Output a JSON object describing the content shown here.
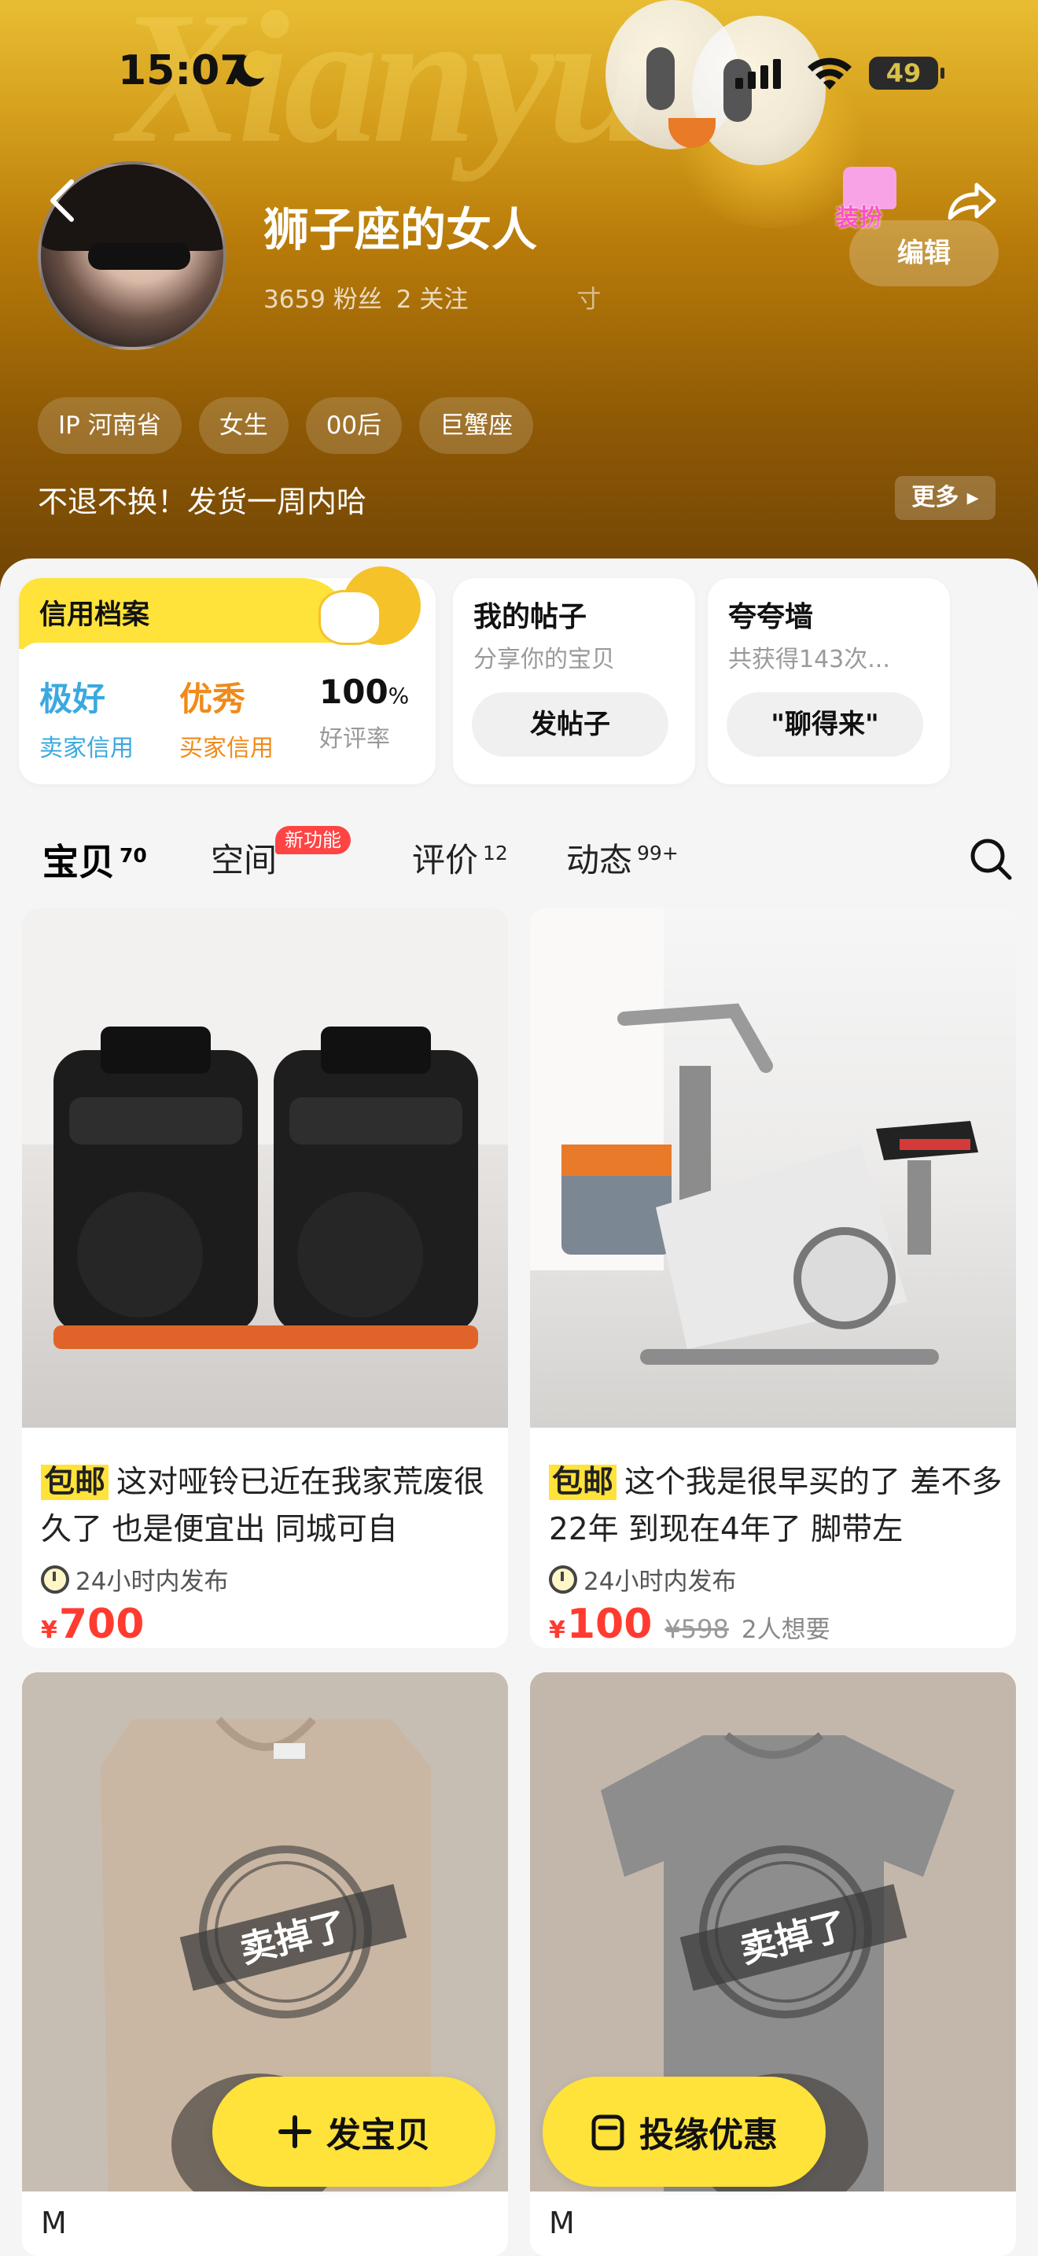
{
  "status_bar": {
    "time": "15:07",
    "battery": "49"
  },
  "profile": {
    "nickname": "狮子座的女人",
    "fans": "3659 粉丝",
    "following": "2 关注",
    "hidden_stat": "寸",
    "dress_badge": "装扮",
    "edit_label": "编辑",
    "tags": [
      "IP 河南省",
      "女生",
      "00后",
      "巨蟹座"
    ],
    "bio": "不退不换！发货一周内哈",
    "more_label": "更多"
  },
  "credit": {
    "title": "信用档案",
    "items": [
      {
        "value": "极好",
        "label": "卖家信用",
        "color": "#3aa9e0"
      },
      {
        "value": "优秀",
        "label": "买家信用",
        "color": "#f08a1a"
      },
      {
        "value": "100",
        "unit": "%",
        "label": "好评率",
        "color": "#111111"
      }
    ]
  },
  "posts_card": {
    "title": "我的帖子",
    "subtitle": "分享你的宝贝",
    "button": "发帖子"
  },
  "praise_card": {
    "title": "夸夸墙",
    "subtitle": "共获得143次...",
    "button": "\"聊得来\""
  },
  "tabs": [
    {
      "label": "宝贝",
      "count": "70"
    },
    {
      "label": "空间",
      "count": ""
    },
    {
      "label": "评价",
      "count": "12"
    },
    {
      "label": "动态",
      "count": "99+"
    }
  ],
  "new_badge": "新功能",
  "products": [
    {
      "free_ship": "包邮",
      "desc": "这对哑铃已近在我家荒废很久了 也是便宜出 同城可自",
      "posted": "24小时内发布",
      "currency": "¥",
      "price": "700"
    },
    {
      "free_ship": "包邮",
      "desc": "这个我是很早买的了 差不多22年 到现在4年了 脚带左",
      "posted": "24小时内发布",
      "currency": "¥",
      "price": "100",
      "original_price": "¥598",
      "wants": "2人想要"
    },
    {
      "size": "M",
      "sold_stamp": "卖掉了"
    },
    {
      "size": "M",
      "sold_stamp": "卖掉了"
    }
  ],
  "fab": {
    "publish": "发宝贝",
    "promo": "投缘优惠"
  },
  "colors": {
    "accent": "#ffe23a",
    "price_red": "#ff3b30"
  }
}
